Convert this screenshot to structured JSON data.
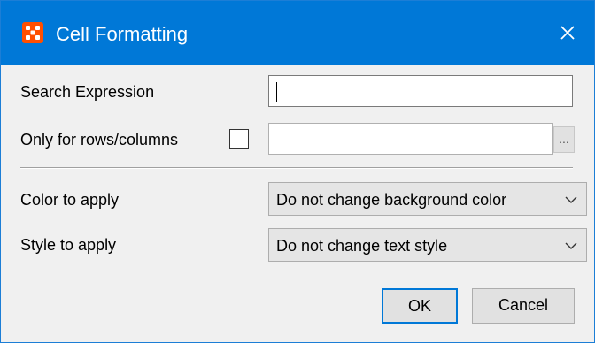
{
  "window": {
    "title": "Cell Formatting",
    "close_icon": "close-icon",
    "app_icon": "app-grid-icon",
    "accent_color": "#0078d7"
  },
  "form": {
    "search_label": "Search Expression",
    "search_value": "",
    "only_label": "Only for rows/columns",
    "only_checked": false,
    "only_value": "",
    "browse_label": "...",
    "color_label": "Color to apply",
    "color_value": "Do not change background color",
    "style_label": "Style to apply",
    "style_value": "Do not change text style"
  },
  "buttons": {
    "ok": "OK",
    "cancel": "Cancel"
  }
}
